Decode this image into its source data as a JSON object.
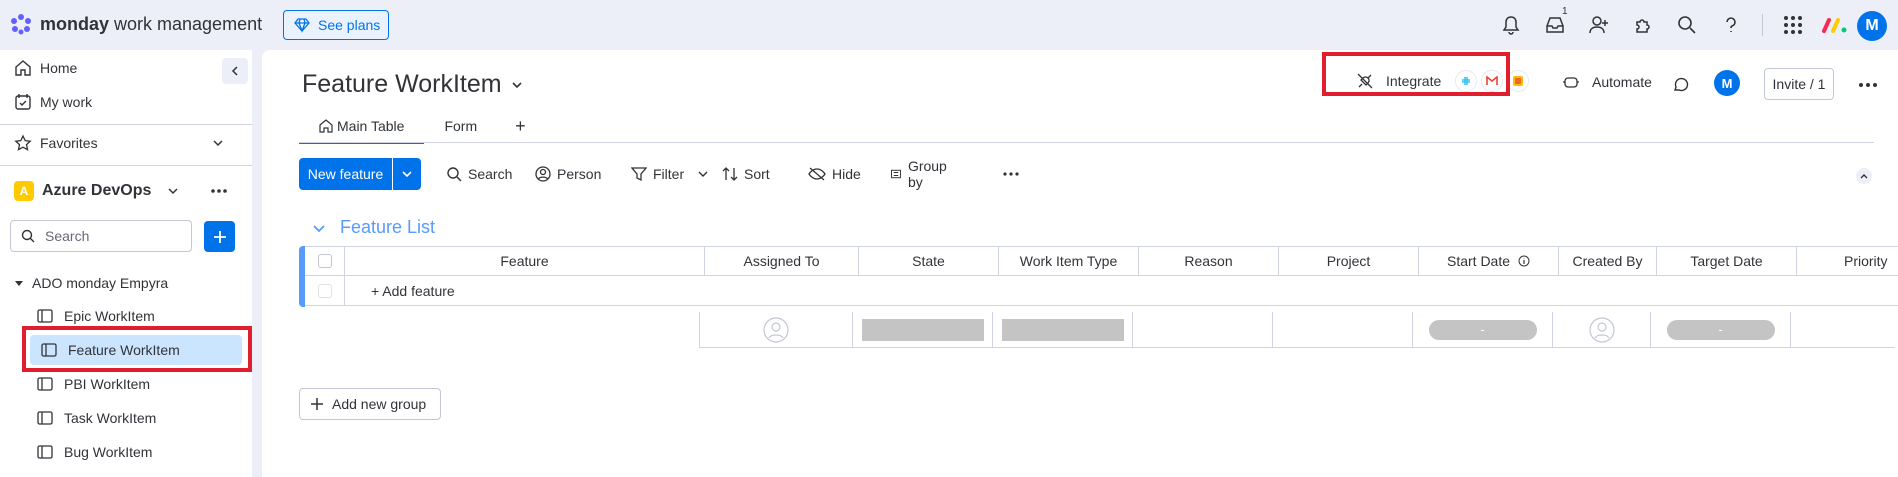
{
  "brand": {
    "name_bold": "monday",
    "name_rest": " work management"
  },
  "top": {
    "see_plans": "See plans",
    "inbox_badge": "1",
    "avatar": "M"
  },
  "sidebar": {
    "home": "Home",
    "my_work": "My work",
    "favorites": "Favorites",
    "workspace": {
      "initial": "A",
      "name": "Azure DevOps"
    },
    "search_placeholder": "Search",
    "folder": "ADO monday Empyra",
    "boards": [
      "Epic WorkItem",
      "Feature WorkItem",
      "PBI WorkItem",
      "Task WorkItem",
      "Bug WorkItem"
    ]
  },
  "board": {
    "title": "Feature WorkItem",
    "tabs": [
      "Main Table",
      "Form"
    ],
    "tab_add": "+",
    "integrate": "Integrate",
    "automate": "Automate",
    "avatar": "M",
    "invite": "Invite / 1"
  },
  "toolbar": {
    "new_item": "New feature",
    "search": "Search",
    "person": "Person",
    "filter": "Filter",
    "sort": "Sort",
    "hide": "Hide",
    "group_by": "Group by"
  },
  "group": {
    "title": "Feature List",
    "columns": [
      "Feature",
      "Assigned To",
      "State",
      "Work Item Type",
      "Reason",
      "Project",
      "Start Date",
      "Created By",
      "Target Date",
      "Priority"
    ],
    "add_row": "+ Add feature",
    "summary_dash": "-"
  },
  "add_group": "Add new group",
  "colors": {
    "accent": "#0073ea",
    "group": "#579bfc",
    "highlight": "#e01e2e",
    "selected": "#cce5ff"
  }
}
